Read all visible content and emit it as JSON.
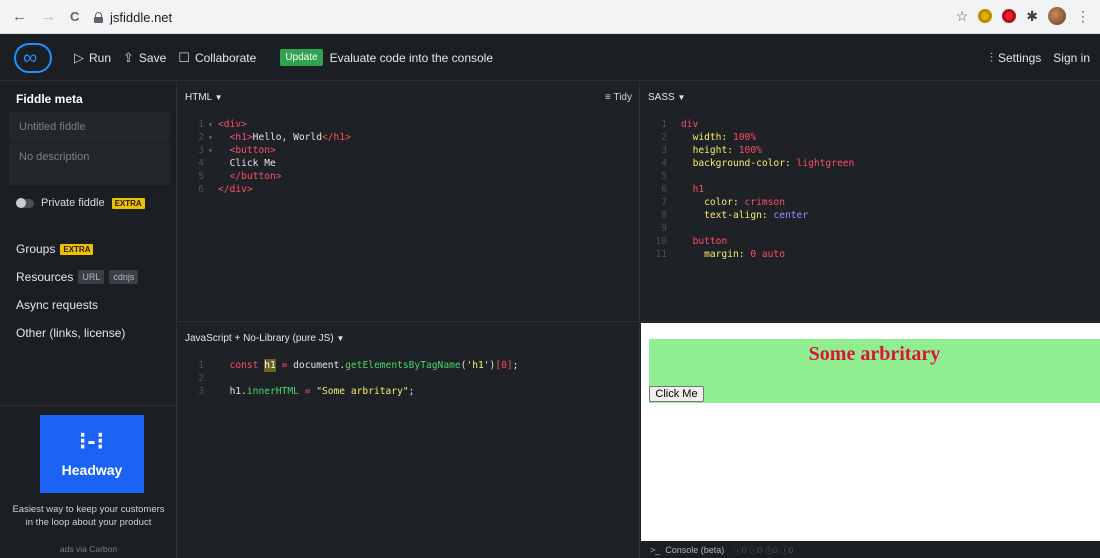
{
  "browser": {
    "back_icon": "←",
    "forward_icon": "→",
    "reload_icon": "C",
    "url": "jsfiddle.net",
    "star_icon": "☆",
    "puzzle_icon": "✱",
    "menu_icon": "⋮"
  },
  "toolbar": {
    "run_label": "Run",
    "save_label": "Save",
    "collaborate_label": "Collaborate",
    "update_label": "Update",
    "update_note": "Evaluate code into the console",
    "settings_label": "Settings",
    "signin_label": "Sign in"
  },
  "sidebar": {
    "title": "Fiddle meta",
    "name_placeholder": "Untitled fiddle",
    "description_placeholder": "No description",
    "private_label": "Private fiddle",
    "extra_badge": "EXTRA",
    "groups_label": "Groups",
    "resources_label": "Resources",
    "resources_tags": [
      "URL",
      "cdnjs"
    ],
    "async_label": "Async requests",
    "other_label": "Other (links, license)",
    "ad": {
      "brand_mark": "⁝-⁝",
      "brand": "Headway",
      "text_line1": "Easiest way to keep your customers",
      "text_line2": "in the loop about your product",
      "via": "ads via Carbon"
    }
  },
  "panels": {
    "html_label": "HTML",
    "tidy_label": "Tidy",
    "sass_label": "SASS",
    "js_label": "JavaScript + No-Library (pure JS)"
  },
  "html_code": {
    "l1_open": "<div>",
    "l2_open": "<h1>",
    "l2_text": "Hello, World",
    "l2_close": "</h1>",
    "l3_open": "<button>",
    "l4_text": "Click Me",
    "l5_close": "</button>",
    "l6_close": "</div>"
  },
  "sass_code": {
    "sel_div": "div",
    "width_prop": "width:",
    "width_val": "100%",
    "height_prop": "height:",
    "height_val": "100%",
    "bg_prop": "background-color:",
    "bg_val": "lightgreen",
    "sel_h1": "h1",
    "color_prop": "color:",
    "color_val": "crimson",
    "align_prop": "text-align:",
    "align_val": "center",
    "sel_button": "button",
    "margin_prop": "margin:",
    "margin_val": "0 auto"
  },
  "js_code": {
    "kw_const": "const",
    "var_h1": "h1",
    "eq": "=",
    "doc": "document.",
    "fn": "getElementsByTagName",
    "arg_open": "(",
    "arg_str": "'h1'",
    "arg_close": ")",
    "idx": "[0]",
    "semi": ";",
    "l3_obj": "h1.",
    "l3_prop": "innerHTML",
    "l3_eq": " = ",
    "l3_str": "\"Some arbritary\"",
    "l3_semi": ";"
  },
  "result": {
    "heading": "Some arbritary",
    "button": "Click Me"
  },
  "console": {
    "label": "Console (beta)",
    "counts": "ⓘ0  ⓘ0  ⚠0  ⓘ0"
  }
}
